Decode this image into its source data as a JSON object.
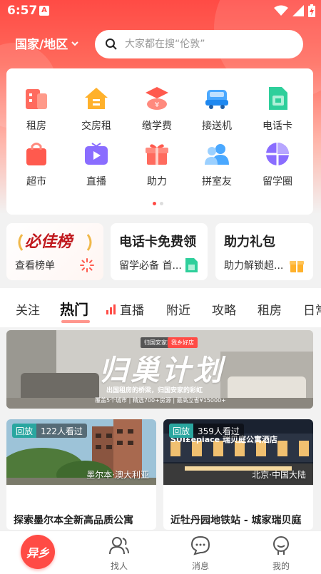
{
  "status_bar": {
    "time": "6:57",
    "app_badge": "A"
  },
  "header": {
    "region_label": "国家/地区",
    "search_placeholder": "大家都在搜“伦敦”"
  },
  "services": [
    {
      "label": "租房",
      "icon": "rent-icon"
    },
    {
      "label": "交房租",
      "icon": "pay-rent-icon"
    },
    {
      "label": "缴学费",
      "icon": "tuition-icon"
    },
    {
      "label": "接送机",
      "icon": "airport-car-icon"
    },
    {
      "label": "电话卡",
      "icon": "sim-card-icon"
    },
    {
      "label": "超市",
      "icon": "supermarket-bag-icon"
    },
    {
      "label": "直播",
      "icon": "live-tv-icon"
    },
    {
      "label": "助力",
      "icon": "gift-icon"
    },
    {
      "label": "拼室友",
      "icon": "roommate-icon"
    },
    {
      "label": "留学圈",
      "icon": "circle-icon"
    }
  ],
  "promos": {
    "rank": {
      "title": "必佳榜",
      "sub": "查看榜单"
    },
    "sim": {
      "title": "电话卡免费领",
      "sub": "留学必备 首..."
    },
    "gift": {
      "title": "助力礼包",
      "sub": "助力解锁超..."
    }
  },
  "tabs": [
    "关注",
    "热门",
    "直播",
    "附近",
    "攻略",
    "租房",
    "日常"
  ],
  "banner": {
    "tag1": "归国安家就上",
    "tag2": "我乡好店",
    "headline": "归巢计划",
    "slogan": "出国租房的桥梁，归国安家的彩虹",
    "details": "覆盖5个城市 | 精选700+房源 | 最高立省¥15000+"
  },
  "live_cards": [
    {
      "badge": "回放",
      "viewers": "122人看过",
      "location": "墨尔本·澳大利亚",
      "caption": "探索墨尔本全新高品质公寓"
    },
    {
      "badge": "回放",
      "viewers": "359人看过",
      "location": "北京·中国大陆",
      "caption": "近牡丹园地铁站 - 城家瑞贝庭"
    }
  ],
  "live_card_2_sign": "SUI£eplace 瑞贝庭公寓酒店",
  "bottom_nav": {
    "home": "异乡",
    "find": "找人",
    "messages": "消息",
    "mine": "我的"
  },
  "colors": {
    "brand": "#ff4b45",
    "live_badge": "#2aa6a0"
  }
}
